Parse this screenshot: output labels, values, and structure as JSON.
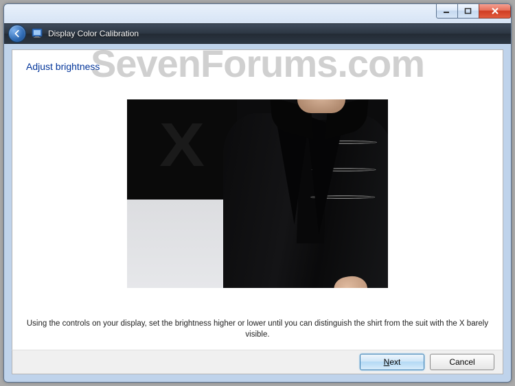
{
  "window": {
    "title": "Display Color Calibration"
  },
  "page": {
    "heading": "Adjust brightness",
    "instruction": "Using the controls on your display, set the brightness higher or lower until you can distinguish the shirt from the suit with the X barely visible."
  },
  "footer": {
    "next_label": "Next",
    "cancel_label": "Cancel"
  },
  "watermark": "SevenForums.com",
  "icons": {
    "back": "arrow-left",
    "minimize": "minimize",
    "maximize": "maximize",
    "close": "close"
  }
}
